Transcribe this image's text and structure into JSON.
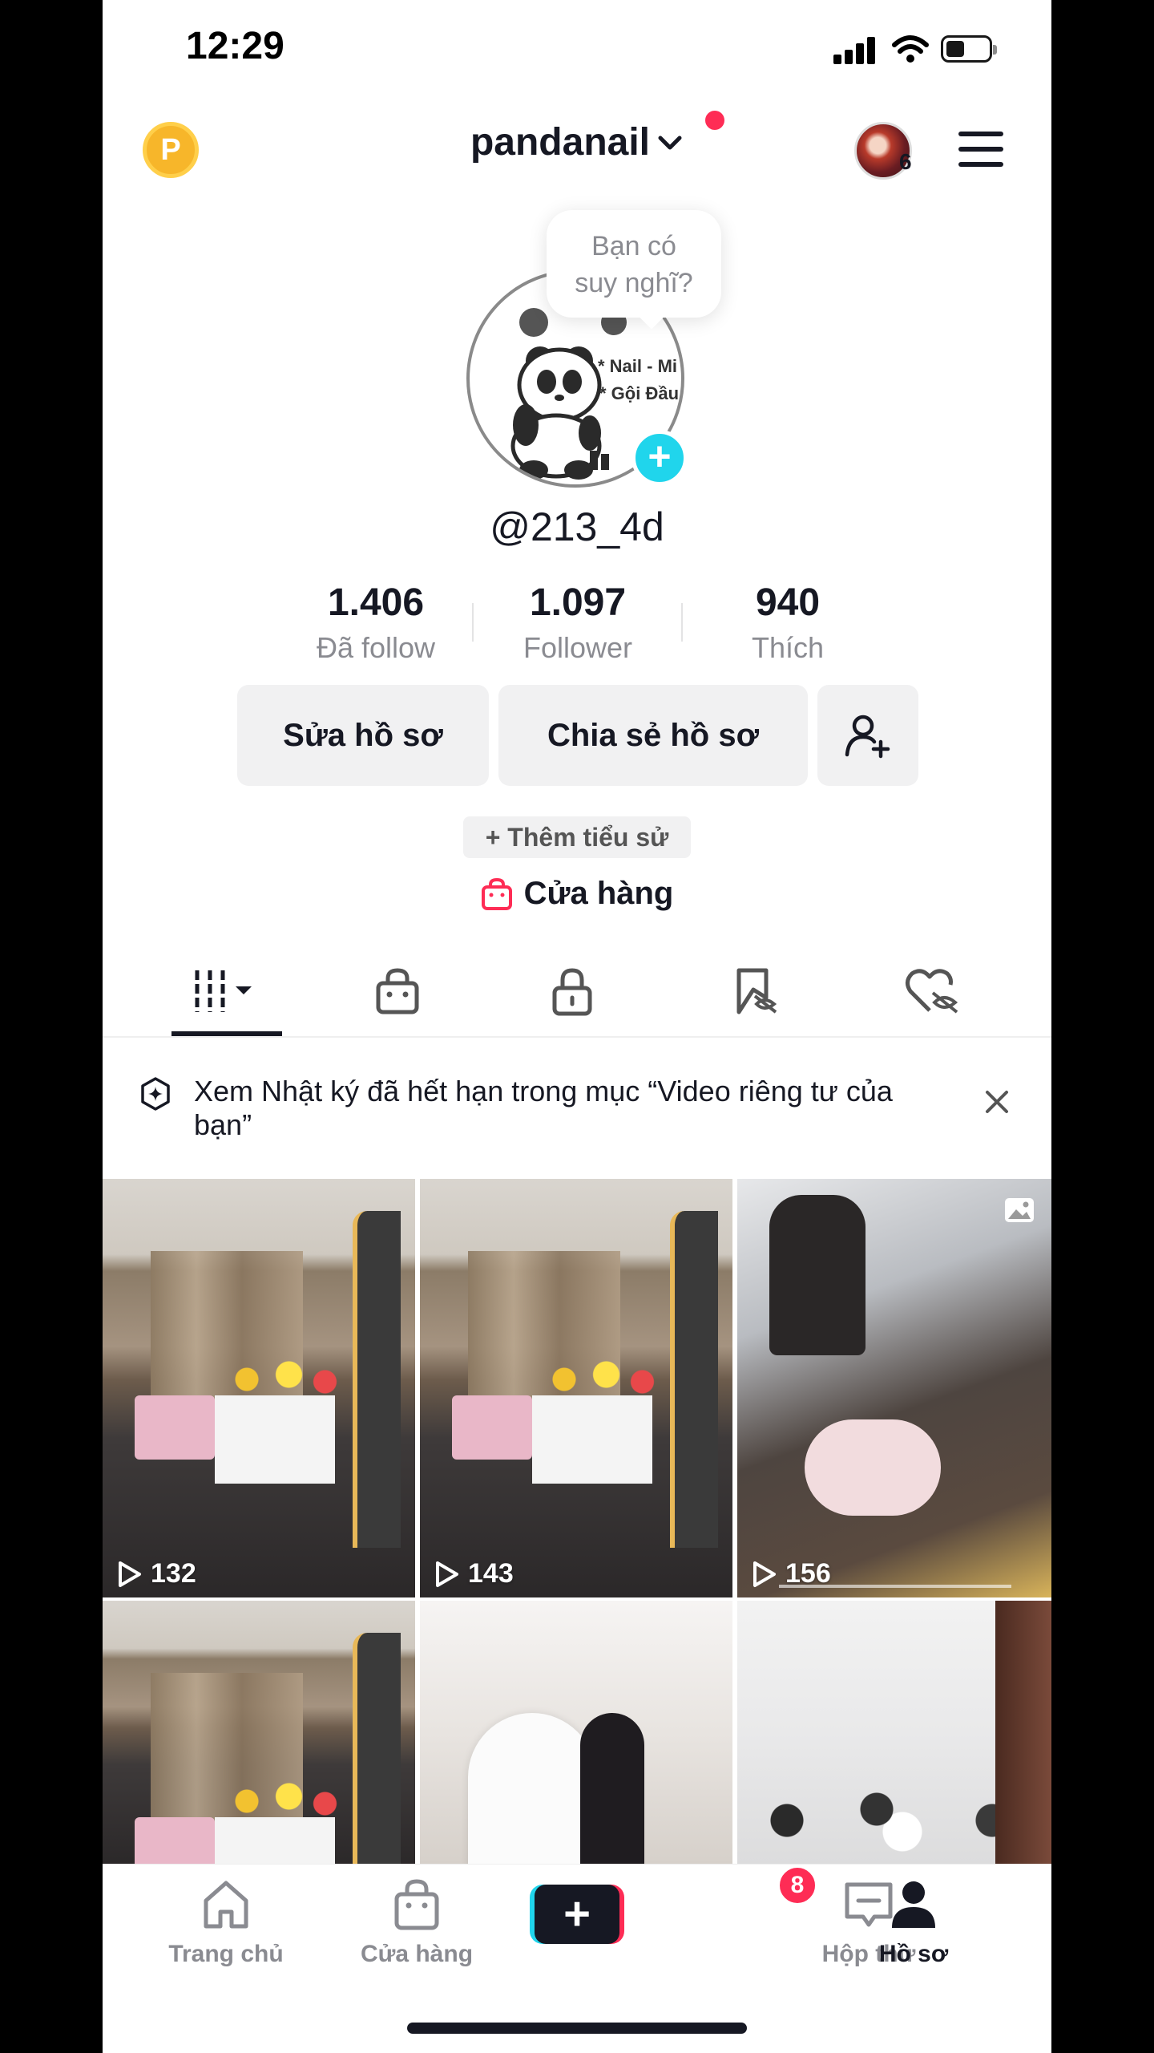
{
  "status_bar": {
    "time": "12:29"
  },
  "header": {
    "coin_letter": "P",
    "username": "pandanail",
    "story_count": "6"
  },
  "profile": {
    "bubble_line1": "Bạn có",
    "bubble_line2": "suy nghĩ?",
    "handle": "@213_4d",
    "avatar_text_1": "* Nail - Mi",
    "avatar_text_2": "* Gội Đầu",
    "stats": [
      {
        "value": "1.406",
        "label": "Đã follow"
      },
      {
        "value": "1.097",
        "label": "Follower"
      },
      {
        "value": "940",
        "label": "Thích"
      }
    ],
    "edit_button": "Sửa hồ sơ",
    "share_button": "Chia sẻ hồ sơ",
    "add_bio": "+ Thêm tiểu sử",
    "shop_link": "Cửa hàng"
  },
  "tabs": [
    {
      "icon": "grid-icon",
      "active": true
    },
    {
      "icon": "shopping-bag-icon"
    },
    {
      "icon": "lock-icon"
    },
    {
      "icon": "bookmark-hidden-icon"
    },
    {
      "icon": "heart-hidden-icon"
    }
  ],
  "notice": {
    "text": "Xem Nhật ký đã hết hạn trong mục “Video riêng tư của bạn”"
  },
  "videos": [
    {
      "views": "132",
      "scene": "room"
    },
    {
      "views": "143",
      "scene": "room"
    },
    {
      "views": "156",
      "scene": "salon"
    },
    {
      "views": "",
      "scene": "room"
    },
    {
      "views": "",
      "scene": "bridal"
    },
    {
      "views": "",
      "scene": "studio"
    }
  ],
  "bottom_nav": {
    "home": "Trang chủ",
    "shop": "Cửa hàng",
    "inbox": "Hộp thư",
    "inbox_badge": "8",
    "profile": "Hồ sơ"
  },
  "colors": {
    "accent_red": "#fe2c55",
    "accent_cyan": "#20d5ec",
    "coin": "#f7b62a"
  }
}
